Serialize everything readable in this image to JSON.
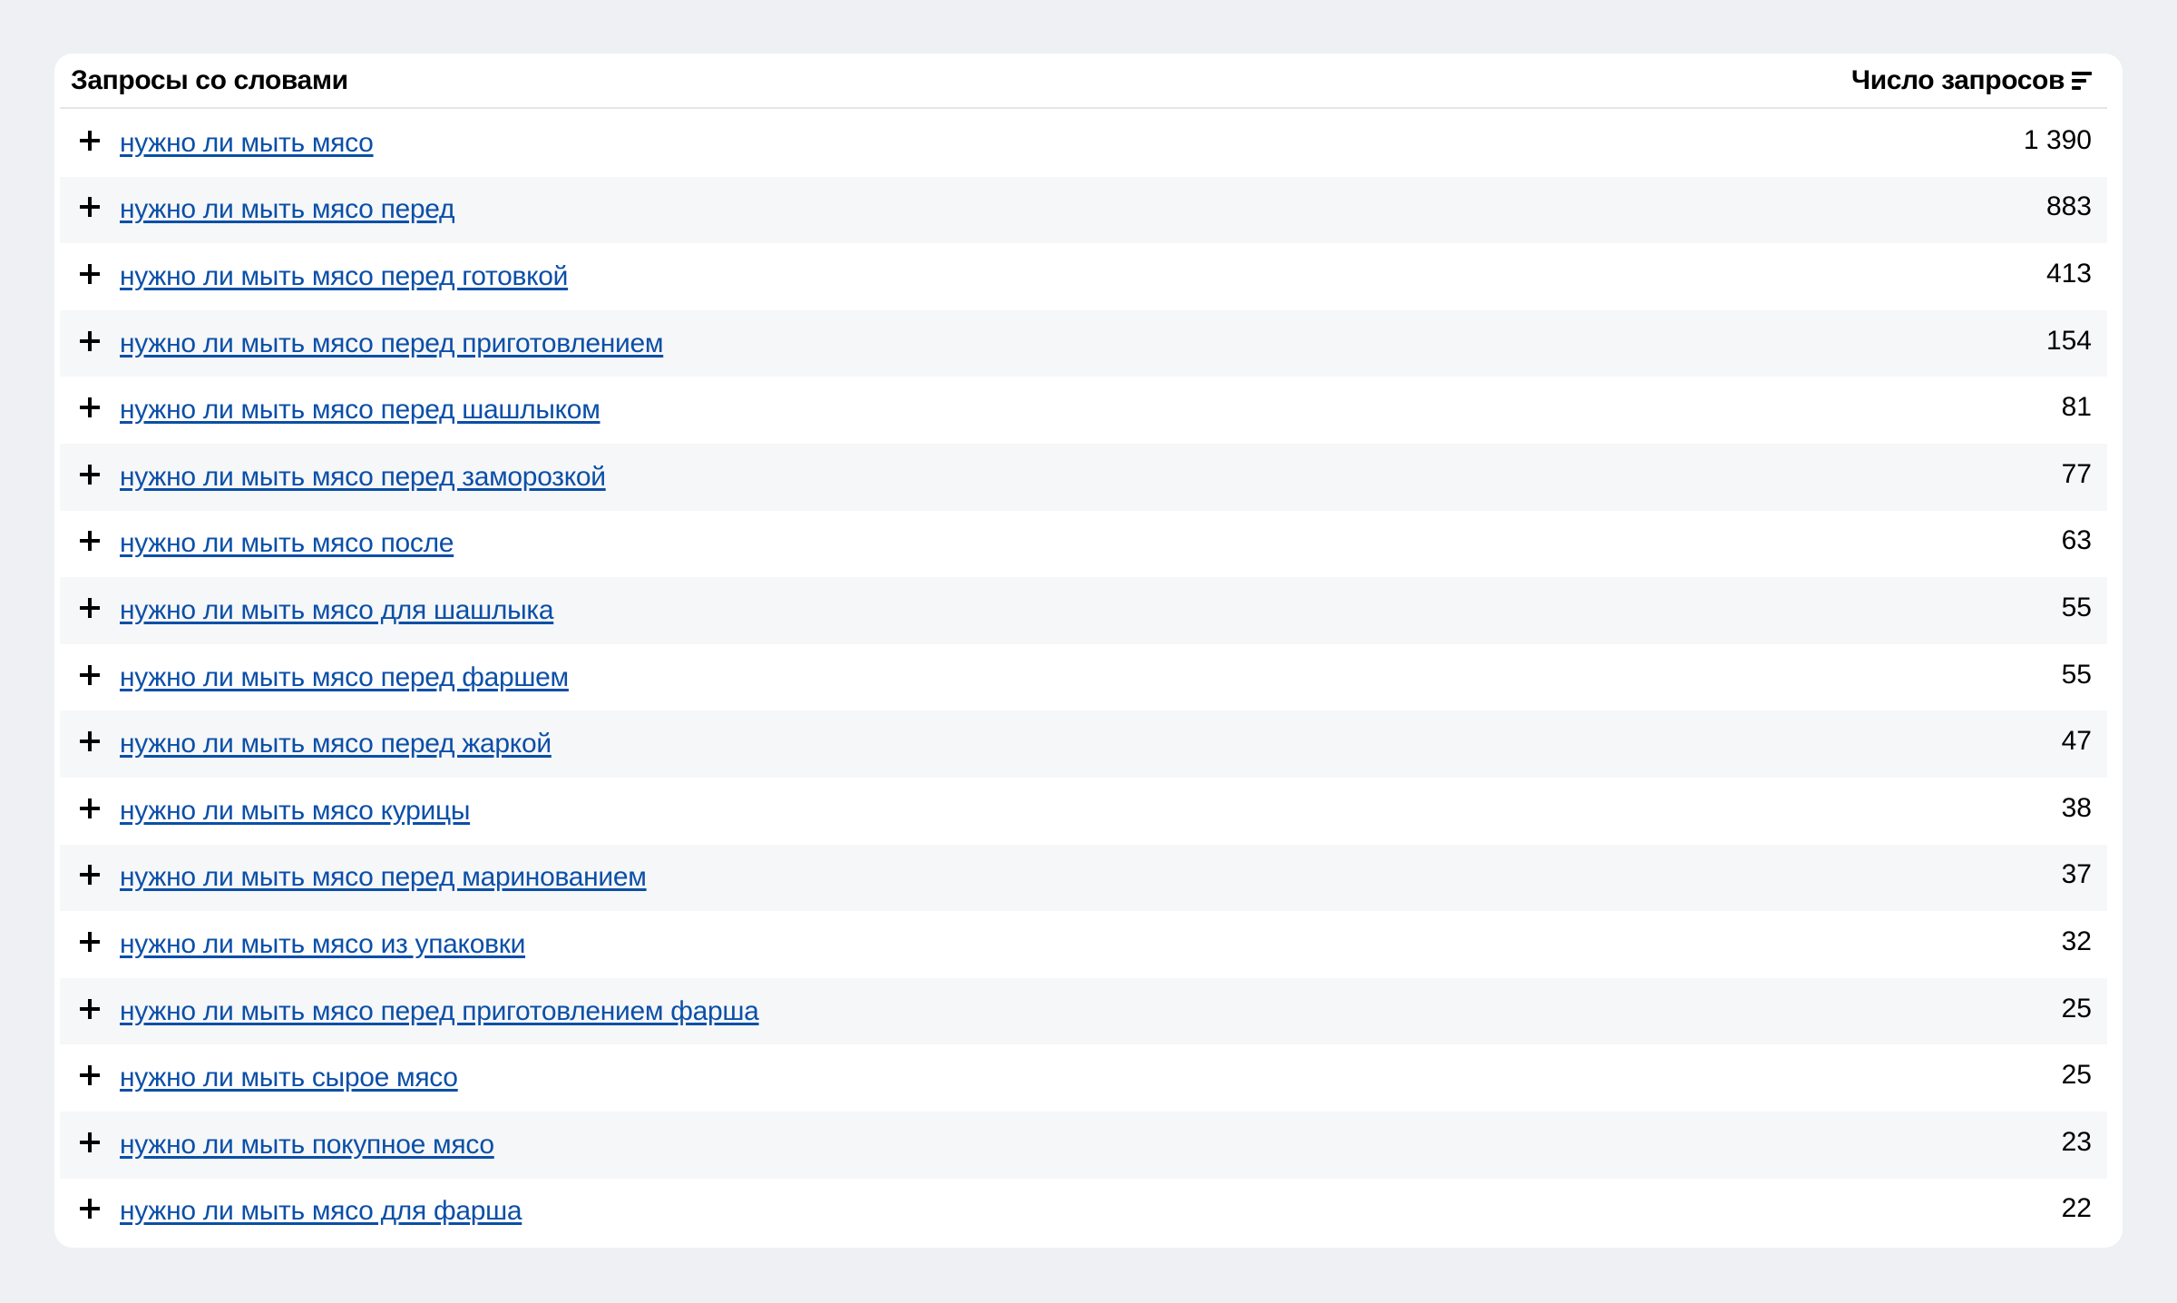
{
  "table": {
    "phrase_header": "Запросы со словами",
    "count_header": "Число запросов",
    "sort_icon": "sort-descending-icon",
    "expand_icon": "plus-icon",
    "link_color": "#0b4fa8",
    "rows": [
      {
        "phrase": "нужно ли мыть мясо",
        "count": "1 390"
      },
      {
        "phrase": "нужно ли мыть мясо перед",
        "count": "883"
      },
      {
        "phrase": "нужно ли мыть мясо перед готовкой",
        "count": "413"
      },
      {
        "phrase": "нужно ли мыть мясо перед приготовлением",
        "count": "154"
      },
      {
        "phrase": "нужно ли мыть мясо перед шашлыком",
        "count": "81"
      },
      {
        "phrase": "нужно ли мыть мясо перед заморозкой",
        "count": "77"
      },
      {
        "phrase": "нужно ли мыть мясо после",
        "count": "63"
      },
      {
        "phrase": "нужно ли мыть мясо для шашлыка",
        "count": "55"
      },
      {
        "phrase": "нужно ли мыть мясо перед фаршем",
        "count": "55"
      },
      {
        "phrase": "нужно ли мыть мясо перед жаркой",
        "count": "47"
      },
      {
        "phrase": "нужно ли мыть мясо курицы",
        "count": "38"
      },
      {
        "phrase": "нужно ли мыть мясо перед маринованием",
        "count": "37"
      },
      {
        "phrase": "нужно ли мыть мясо из упаковки",
        "count": "32"
      },
      {
        "phrase": "нужно ли мыть мясо перед приготовлением фарша",
        "count": "25"
      },
      {
        "phrase": "нужно ли мыть сырое мясо",
        "count": "25"
      },
      {
        "phrase": "нужно ли мыть покупное мясо",
        "count": "23"
      },
      {
        "phrase": "нужно ли мыть мясо для фарша",
        "count": "22"
      }
    ]
  }
}
